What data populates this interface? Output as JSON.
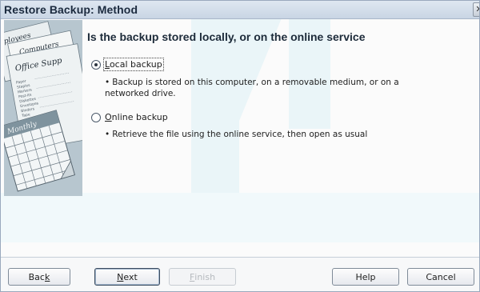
{
  "window": {
    "title": "Restore Backup: Method",
    "close_glyph": "✕"
  },
  "side_art": {
    "icon": "office-calendar-illustration",
    "words": [
      "mployees",
      "Computers",
      "Office Supp",
      "Monthly"
    ],
    "tiny_lines": [
      "Paper",
      "Staples",
      "Markers",
      "Post-its",
      "Diskettes",
      "Envelopes",
      "Binders",
      "Tape"
    ]
  },
  "main": {
    "question": "Is the backup stored locally, or on the online service",
    "options": [
      {
        "label_prefix": "",
        "label_mnemonic": "L",
        "label_rest": "ocal backup",
        "selected": true,
        "bullet": "•",
        "description": "Backup is stored on this computer, on a removable medium, or on a networked drive."
      },
      {
        "label_prefix": "",
        "label_mnemonic": "O",
        "label_rest": "nline backup",
        "selected": false,
        "bullet": "•",
        "description": "Retrieve the file using the online service, then open as usual"
      }
    ]
  },
  "footer": {
    "back": {
      "prefix": "Bac",
      "mnemonic": "k",
      "suffix": ""
    },
    "next": {
      "prefix": "",
      "mnemonic": "N",
      "suffix": "ext"
    },
    "finish": {
      "prefix": "",
      "mnemonic": "F",
      "suffix": "inish"
    },
    "help": "Help",
    "cancel": "Cancel"
  },
  "colors": {
    "title_bar": "#c9d5e4",
    "watermark": "#eaf5f8"
  }
}
